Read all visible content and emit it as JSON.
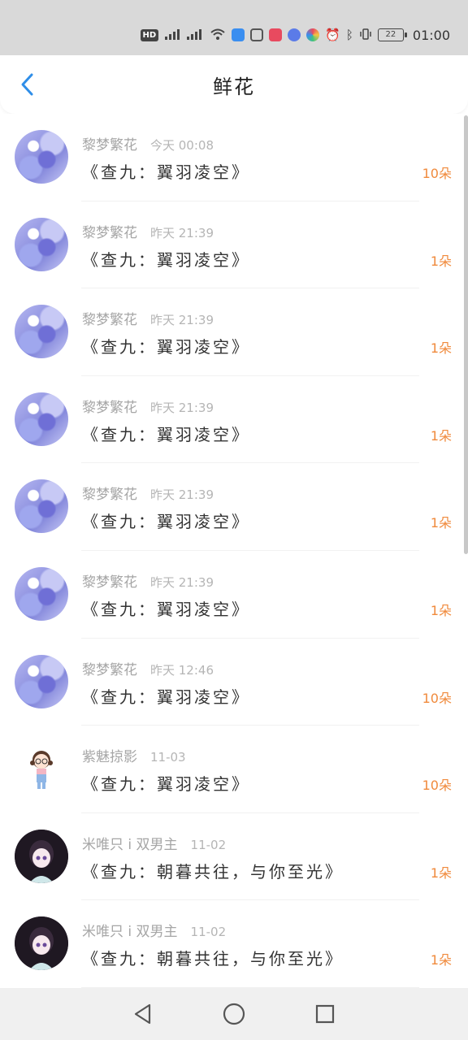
{
  "status_bar": {
    "hd_label": "HD",
    "battery": "22",
    "time": "01:00"
  },
  "header": {
    "title": "鲜花"
  },
  "rows": [
    {
      "user": "黎梦繁花",
      "time": "今天 00:08",
      "book": "《查九：翼羽凌空》",
      "count": "10朵",
      "avatar": "lavender"
    },
    {
      "user": "黎梦繁花",
      "time": "昨天 21:39",
      "book": "《查九：翼羽凌空》",
      "count": "1朵",
      "avatar": "lavender"
    },
    {
      "user": "黎梦繁花",
      "time": "昨天 21:39",
      "book": "《查九：翼羽凌空》",
      "count": "1朵",
      "avatar": "lavender"
    },
    {
      "user": "黎梦繁花",
      "time": "昨天 21:39",
      "book": "《查九：翼羽凌空》",
      "count": "1朵",
      "avatar": "lavender"
    },
    {
      "user": "黎梦繁花",
      "time": "昨天 21:39",
      "book": "《查九：翼羽凌空》",
      "count": "1朵",
      "avatar": "lavender"
    },
    {
      "user": "黎梦繁花",
      "time": "昨天 21:39",
      "book": "《查九：翼羽凌空》",
      "count": "1朵",
      "avatar": "lavender"
    },
    {
      "user": "黎梦繁花",
      "time": "昨天 12:46",
      "book": "《查九：翼羽凌空》",
      "count": "10朵",
      "avatar": "lavender"
    },
    {
      "user": "紫魅掠影",
      "time": "11-03",
      "book": "《查九：翼羽凌空》",
      "count": "10朵",
      "avatar": "cartoon"
    },
    {
      "user": "米唯只 i 双男主",
      "time": "11-02",
      "book": "《查九：朝暮共往，与你至光》",
      "count": "1朵",
      "avatar": "dark"
    },
    {
      "user": "米唯只 i 双男主",
      "time": "11-02",
      "book": "《查九：朝暮共往，与你至光》",
      "count": "1朵",
      "avatar": "dark"
    }
  ],
  "colors": {
    "accent_blue": "#2f8ee8",
    "count_orange": "#f08a3c"
  },
  "icons": {
    "back": "chevron-left-icon",
    "nav_back": "triangle-back-icon",
    "nav_home": "circle-home-icon",
    "nav_recents": "square-recents-icon"
  }
}
